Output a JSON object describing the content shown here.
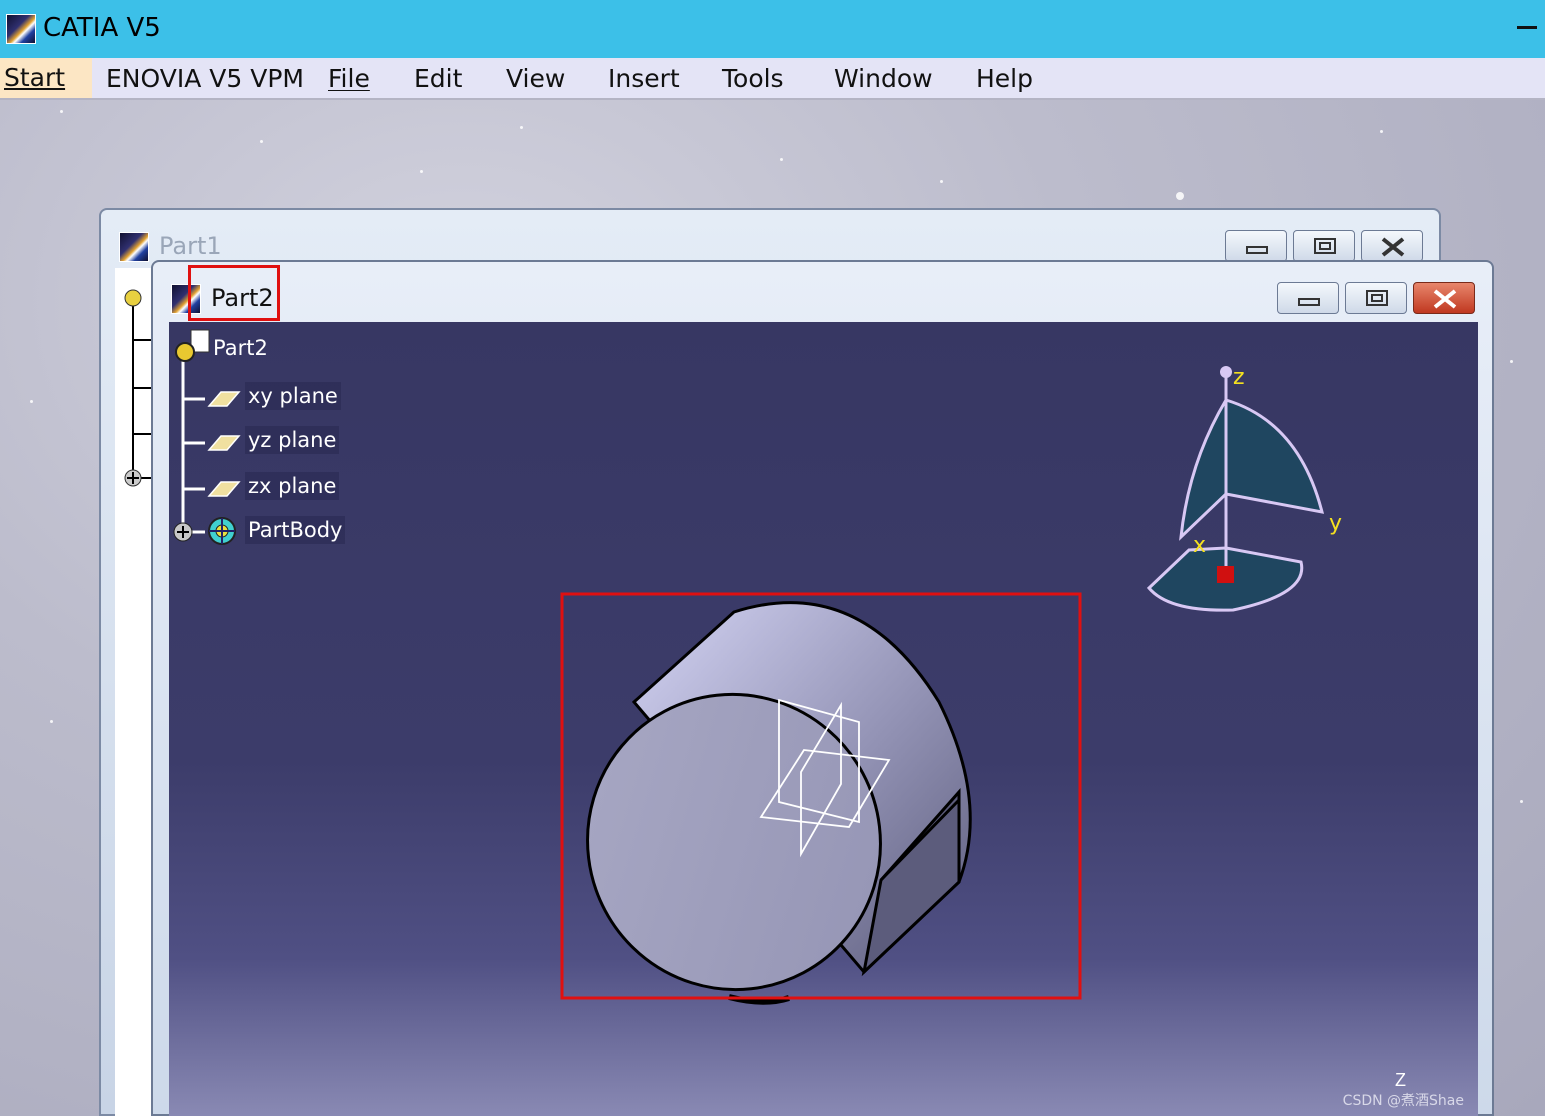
{
  "app": {
    "title": "CATIA V5"
  },
  "menu": {
    "items": [
      {
        "id": "start",
        "label": "Start",
        "underline": "S"
      },
      {
        "id": "enovia",
        "label": "ENOVIA V5 VPM"
      },
      {
        "id": "file",
        "label": "File"
      },
      {
        "id": "edit",
        "label": "Edit"
      },
      {
        "id": "view",
        "label": "View"
      },
      {
        "id": "insert",
        "label": "Insert"
      },
      {
        "id": "tools",
        "label": "Tools"
      },
      {
        "id": "window",
        "label": "Window"
      },
      {
        "id": "help",
        "label": "Help"
      }
    ]
  },
  "windows": {
    "back": {
      "title": "Part1"
    },
    "front": {
      "title": "Part2"
    }
  },
  "tree": {
    "root": "Part2",
    "items": [
      {
        "label": "xy plane",
        "icon": "plane-icon"
      },
      {
        "label": "yz plane",
        "icon": "plane-icon"
      },
      {
        "label": "zx plane",
        "icon": "plane-icon"
      },
      {
        "label": "PartBody",
        "icon": "partbody-icon"
      }
    ]
  },
  "compass": {
    "x_label": "x",
    "y_label": "y",
    "z_label": "z"
  },
  "viewport": {
    "small_axis_label": "Z"
  },
  "watermark": "CSDN @煮酒Shae",
  "colors": {
    "titlebar": "#3cc0e8",
    "menubar": "#e4e4f6",
    "viewport_top": "#373763",
    "highlight": "#e01010"
  }
}
